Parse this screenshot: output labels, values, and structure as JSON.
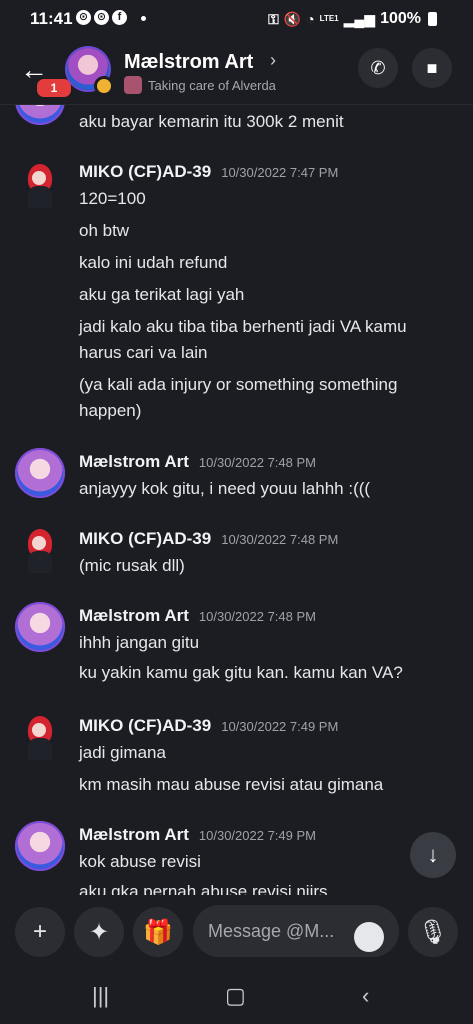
{
  "status_bar": {
    "time": "11:41",
    "battery": "100%",
    "network": "LTE1"
  },
  "header": {
    "title": "Mælstrom Art",
    "subtitle": "Taking care of Alverda",
    "unread_badge": "1"
  },
  "messages": [
    {
      "author": "",
      "timestamp": "",
      "lines": [
        "aku bayar kemarin itu 300k 2 menit"
      ]
    },
    {
      "author": "MIKO (CF)AD-39",
      "timestamp": "10/30/2022 7:47 PM",
      "lines": [
        "120=100",
        "oh btw",
        "kalo ini udah refund",
        "aku ga terikat lagi yah",
        "jadi kalo aku tiba tiba berhenti jadi VA kamu",
        "harus cari va lain",
        "(ya kali ada injury or something something",
        "happen)"
      ]
    },
    {
      "author": "Mælstrom Art",
      "timestamp": "10/30/2022 7:48 PM",
      "lines": [
        "anjayyy kok gitu, i need youu lahhh :((("
      ]
    },
    {
      "author": "MIKO (CF)AD-39",
      "timestamp": "10/30/2022 7:48 PM",
      "lines": [
        "(mic rusak dll)"
      ]
    },
    {
      "author": "Mælstrom Art",
      "timestamp": "10/30/2022 7:48 PM",
      "lines": [
        "ihhh jangan gitu",
        "ku yakin kamu gak gitu kan. kamu kan VA?"
      ]
    },
    {
      "author": "MIKO (CF)AD-39",
      "timestamp": "10/30/2022 7:49 PM",
      "lines": [
        "jadi gimana",
        "km masih mau abuse revisi atau gimana"
      ]
    },
    {
      "author": "Mælstrom Art",
      "timestamp": "10/30/2022 7:49 PM",
      "lines": [
        "kok abuse revisi",
        "aku gka pernah abuse revisi njirs"
      ]
    }
  ],
  "composer": {
    "placeholder": "Message @M..."
  },
  "icons": {
    "back": "arrow-left-icon",
    "call": "phone-icon",
    "video": "video-camera-icon",
    "add": "plus-icon",
    "apps": "apps-icon",
    "gift": "gift-icon",
    "emoji": "emoji-icon",
    "mic": "microphone-icon",
    "scroll": "chevron-down-icon"
  },
  "colors": {
    "background": "#1c1d22",
    "badge": "#e23c3c",
    "status_idle": "#f0b232"
  }
}
